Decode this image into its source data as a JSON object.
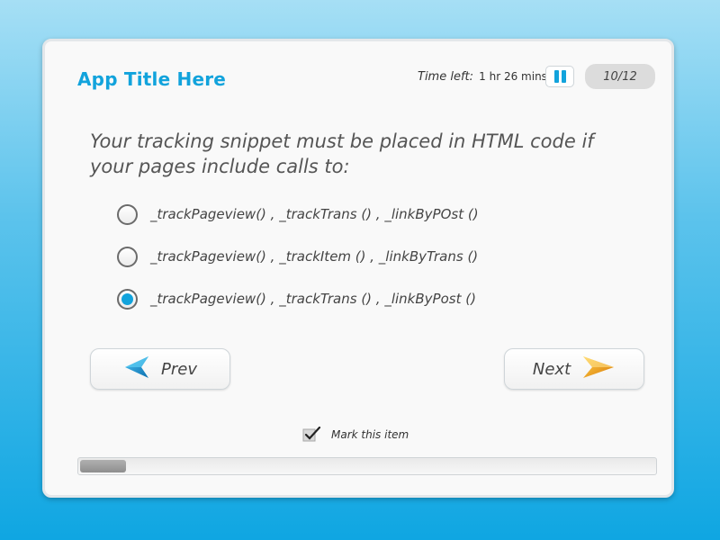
{
  "header": {
    "app_title": "App Title Here",
    "time_left_label": "Time left:",
    "time_left_value": "1 hr 26 mins",
    "counter": "10/12"
  },
  "question": {
    "text": "Your tracking snippet must be placed in HTML code if your pages include calls to:",
    "options": [
      {
        "label": "_trackPageview() , _trackTrans () , _linkByPOst ()",
        "selected": false
      },
      {
        "label": "_trackPageview() , _trackItem () , _linkByTrans ()",
        "selected": false
      },
      {
        "label": "_trackPageview() , _trackTrans () , _linkByPost ()",
        "selected": true
      }
    ]
  },
  "nav": {
    "prev_label": "Prev",
    "next_label": "Next"
  },
  "mark": {
    "label": "Mark this item",
    "checked": true
  },
  "progress": {
    "value": 0.08
  },
  "colors": {
    "accent": "#12a3dc",
    "next_arrow": "#f0a020",
    "prev_arrow": "#1a8fd0"
  },
  "icons": {
    "pause": "pause-icon",
    "prev": "arrow-left-icon",
    "next": "arrow-right-icon",
    "check": "checkmark-icon"
  }
}
